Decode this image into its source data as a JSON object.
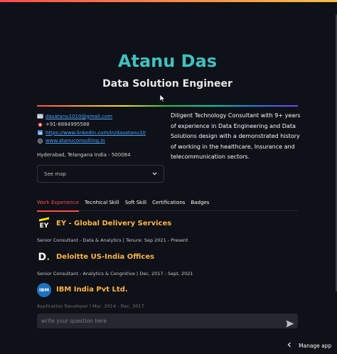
{
  "header": {
    "name": "Atanu Das",
    "role": "Data Solution Engineer"
  },
  "contacts": {
    "email": "dasatanu1010@gmail.com",
    "phone": "+91-8884995588",
    "linkedin": "https://www.linkedin.com/in/dasatanu10",
    "website": "www.atanuconsulting.in",
    "address": "Hyderabad, Telangana India - 500084"
  },
  "about": "Diligent Technology Consultant with 9+ years of experience in Data Engineering and Data Solutions design with a demonstrated history of working in the healthcare, Insurance and telecommunication sectors.",
  "map": {
    "label": "See map"
  },
  "tabs": [
    {
      "label": "Work Experience",
      "active": true
    },
    {
      "label": "Tecnhical Skill",
      "active": false
    },
    {
      "label": "Soft Skill",
      "active": false
    },
    {
      "label": "Certifications",
      "active": false
    },
    {
      "label": "Badges",
      "active": false
    }
  ],
  "jobs": [
    {
      "logo": "EY",
      "company": "EY - Global Delivery Services",
      "role": "Senior Consultant - Data & Analytics | Tenure: Sep 2021 - Present"
    },
    {
      "logo": "D",
      "company": "Deloitte US-India Offices",
      "role": "Senior Consultant - Analytics & Congnitive | Dec, 2017 - Sept, 2021"
    },
    {
      "logo": "IBM",
      "company": "IBM India Pvt Ltd.",
      "role": "Application Developer | Mar, 2014 - Dec, 2017"
    }
  ],
  "chat": {
    "placeholder": "write your question here"
  },
  "footer": {
    "manage_label": "Manage app"
  },
  "colors": {
    "accent": "#ff4b4b",
    "title": "#3fc1c0",
    "company": "#ffb347",
    "link": "#4aa3ff"
  }
}
